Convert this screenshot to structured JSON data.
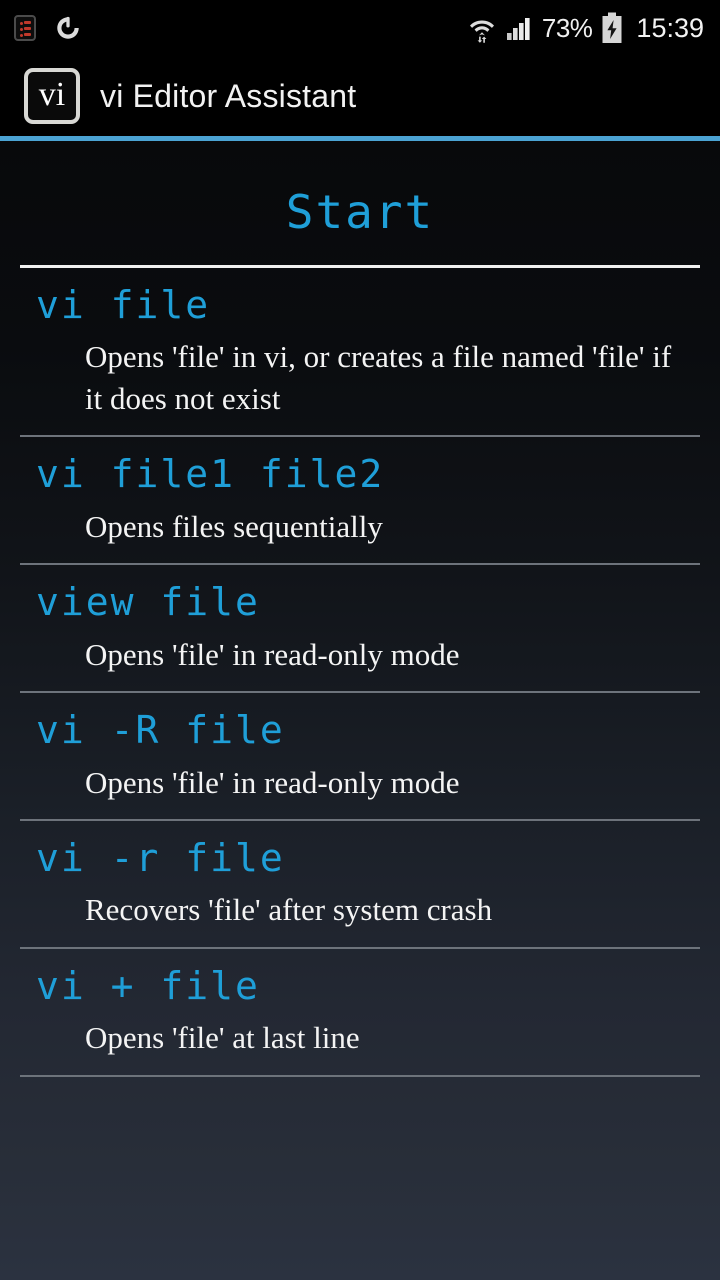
{
  "status_bar": {
    "icons_left": [
      "notifications-list-icon",
      "battery-saver-icon"
    ],
    "wifi_icon": "wifi-icon",
    "signal_icon": "cellular-signal-icon",
    "battery_percent": "73%",
    "battery_icon": "battery-charging-icon",
    "clock": "15:39"
  },
  "app_bar": {
    "icon_text": "vi",
    "title": "vi Editor Assistant"
  },
  "page": {
    "title": "Start"
  },
  "accent_color": "#4ba3d3",
  "command_color": "#1f9fd8",
  "entries": [
    {
      "command": "vi file",
      "description": "Opens 'file' in vi, or creates a file named 'file' if it does not exist"
    },
    {
      "command": "vi file1 file2",
      "description": "Opens files sequentially"
    },
    {
      "command": "view file",
      "description": "Opens 'file' in read-only mode"
    },
    {
      "command": "vi -R file",
      "description": "Opens 'file' in read-only mode"
    },
    {
      "command": "vi -r file",
      "description": "Recovers 'file' after system crash"
    },
    {
      "command": "vi + file",
      "description": "Opens 'file' at last line"
    }
  ]
}
